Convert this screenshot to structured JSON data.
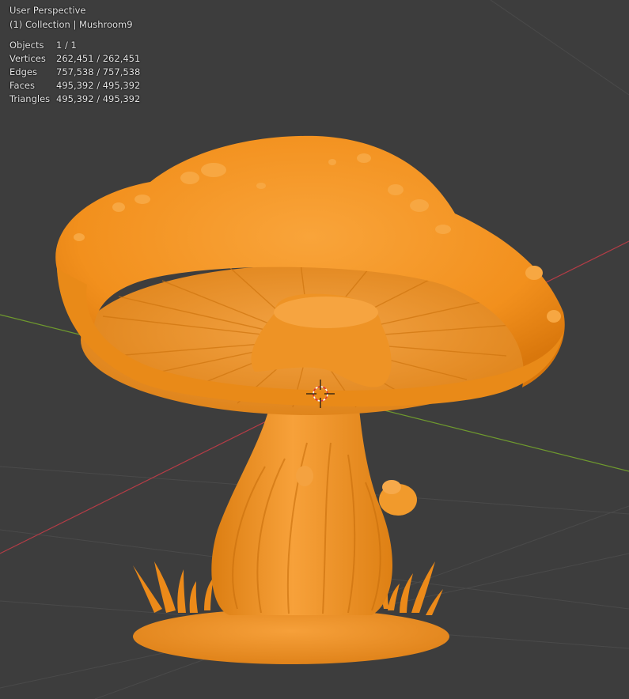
{
  "viewport": {
    "view_name": "User Perspective",
    "collection_line": "(1) Collection | Mushroom9",
    "background_color": "#3d3d3d",
    "mesh_color": "#f7941d",
    "x_axis_color": "#b43c46",
    "y_axis_color": "#6f9a2e"
  },
  "stats": [
    {
      "label": "Objects",
      "value": "1 / 1"
    },
    {
      "label": "Vertices",
      "value": "262,451 / 262,451"
    },
    {
      "label": "Edges",
      "value": "757,538 / 757,538"
    },
    {
      "label": "Faces",
      "value": "495,392 / 495,392"
    },
    {
      "label": "Triangles",
      "value": "495,392 / 495,392"
    }
  ],
  "icons": {
    "cursor": "3d-cursor-icon"
  }
}
